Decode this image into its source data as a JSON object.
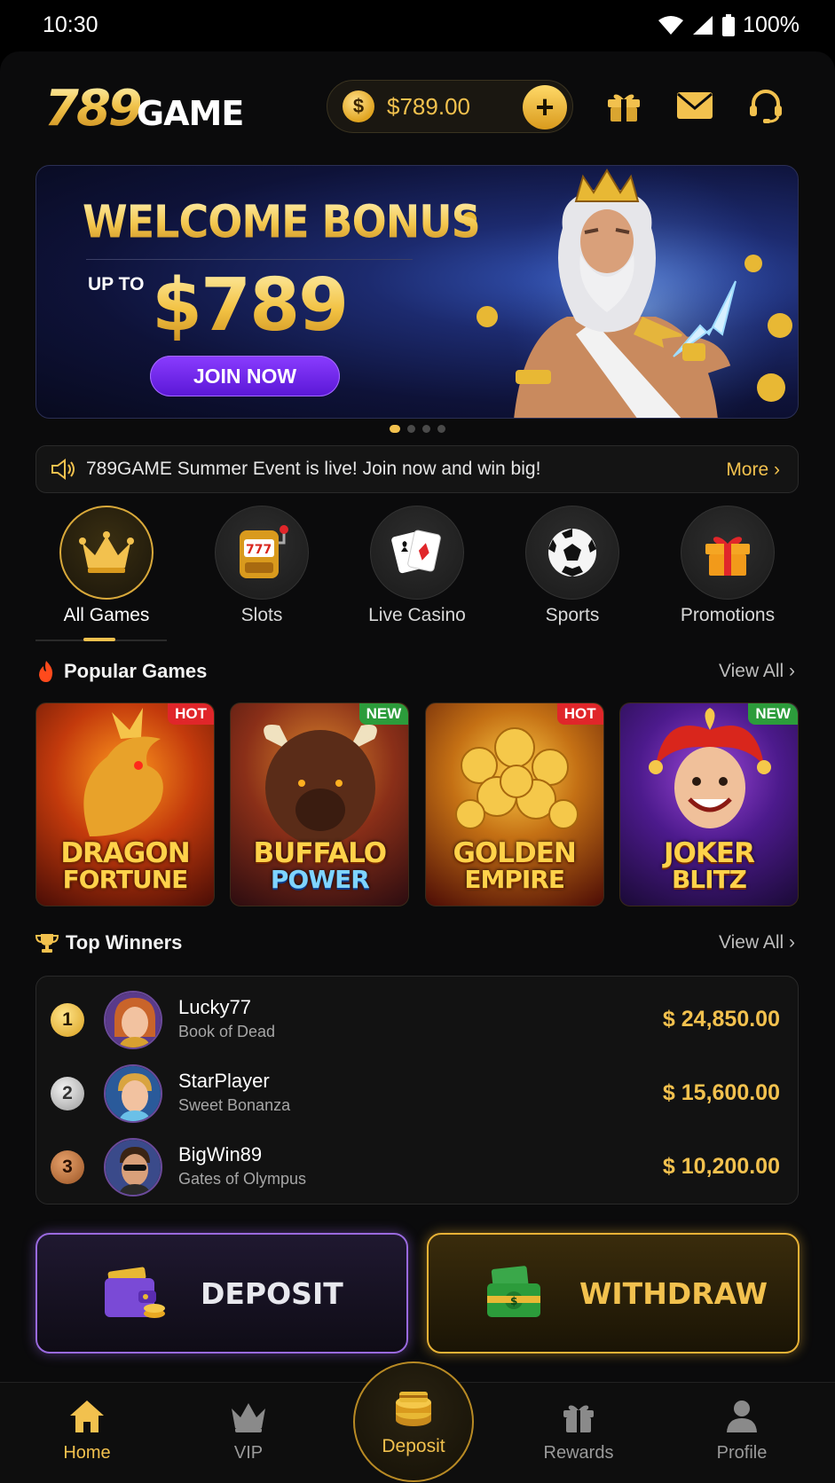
{
  "status": {
    "time": "10:30",
    "battery": "100%"
  },
  "header": {
    "logo_number": "789",
    "logo_word": "GAME",
    "balance": "$789.00",
    "coin_symbol": "$",
    "add_symbol": "+"
  },
  "banner": {
    "title": "WELCOME BONUS",
    "up_to": "UP TO",
    "amount": "$789",
    "cta": "JOIN NOW",
    "slides": 4,
    "active_slide": 1
  },
  "notice": {
    "text": "789GAME Summer Event is live! Join now and win big!",
    "more": "More ›"
  },
  "categories": [
    {
      "label": "All Games",
      "icon": "crown-icon",
      "active": true
    },
    {
      "label": "Slots",
      "icon": "slot-machine-icon",
      "active": false
    },
    {
      "label": "Live Casino",
      "icon": "playing-cards-icon",
      "active": false
    },
    {
      "label": "Sports",
      "icon": "soccer-ball-icon",
      "active": false
    },
    {
      "label": "Promotions",
      "icon": "gift-icon",
      "active": false
    }
  ],
  "popular": {
    "title": "Popular Games",
    "view_all": "View All ›",
    "games": [
      {
        "line1": "DRAGON",
        "line2": "FORTUNE",
        "badge": "HOT"
      },
      {
        "line1": "BUFFALO",
        "line2": "POWER",
        "badge": "NEW"
      },
      {
        "line1": "GOLDEN",
        "line2": "EMPIRE",
        "badge": "HOT"
      },
      {
        "line1": "JOKER",
        "line2": "BLITZ",
        "badge": "NEW"
      }
    ]
  },
  "winners": {
    "title": "Top Winners",
    "view_all": "View All ›",
    "rows": [
      {
        "rank": "1",
        "name": "Lucky77",
        "game": "Book of Dead",
        "amount": "$ 24,850.00"
      },
      {
        "rank": "2",
        "name": "StarPlayer",
        "game": "Sweet Bonanza",
        "amount": "$ 15,600.00"
      },
      {
        "rank": "3",
        "name": "BigWin89",
        "game": "Gates of Olympus",
        "amount": "$ 10,200.00"
      }
    ]
  },
  "actions": {
    "deposit": "DEPOSIT",
    "withdraw": "WITHDRAW"
  },
  "nav": {
    "home": "Home",
    "vip": "VIP",
    "deposit": "Deposit",
    "rewards": "Rewards",
    "profile": "Profile"
  },
  "colors": {
    "gold": "#f2c14e",
    "purple": "#7a2cf0",
    "background": "#0b0b0c"
  }
}
